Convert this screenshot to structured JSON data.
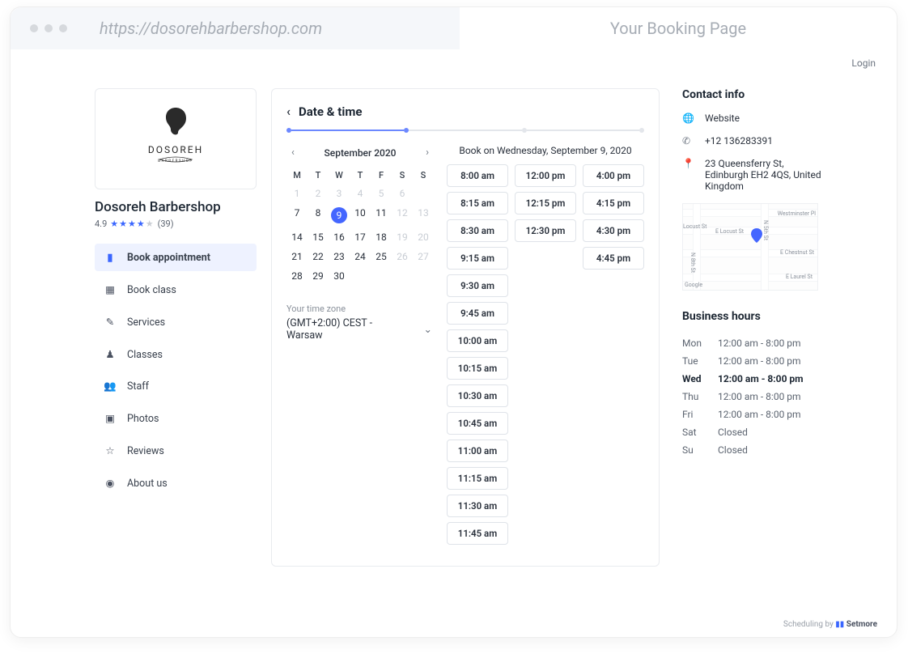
{
  "browser": {
    "url": "https://dosorehbarbershop.com",
    "tab_title": "Your Booking Page",
    "login": "Login"
  },
  "business": {
    "brand_top": "DOSOREH",
    "brand_sub": "BARBERSHOP",
    "name": "Dosoreh Barbershop",
    "rating": "4.9",
    "reviews_count": "(39)"
  },
  "nav": [
    {
      "icon": "briefcase",
      "label": "Book appointment",
      "active": true
    },
    {
      "icon": "calendar",
      "label": "Book class"
    },
    {
      "icon": "pencil",
      "label": "Services"
    },
    {
      "icon": "pawn",
      "label": "Classes"
    },
    {
      "icon": "users",
      "label": "Staff"
    },
    {
      "icon": "image",
      "label": "Photos"
    },
    {
      "icon": "star",
      "label": "Reviews"
    },
    {
      "icon": "pin",
      "label": "About us"
    }
  ],
  "main": {
    "title": "Date & time",
    "calendar": {
      "month_label": "September 2020",
      "dow": [
        "M",
        "T",
        "W",
        "T",
        "F",
        "S",
        "S"
      ],
      "weeks": [
        [
          {
            "n": "1",
            "dim": true
          },
          {
            "n": "2",
            "dim": true
          },
          {
            "n": "3",
            "dim": true
          },
          {
            "n": "4",
            "dim": true
          },
          {
            "n": "5",
            "dim": true
          },
          {
            "n": "6",
            "dim": true
          },
          {
            "n": "",
            "dim": true
          }
        ],
        [
          {
            "n": "7"
          },
          {
            "n": "8"
          },
          {
            "n": "9",
            "sel": true
          },
          {
            "n": "10"
          },
          {
            "n": "11"
          },
          {
            "n": "12",
            "dim": true
          },
          {
            "n": "13",
            "dim": true
          }
        ],
        [
          {
            "n": "14"
          },
          {
            "n": "15"
          },
          {
            "n": "16"
          },
          {
            "n": "17"
          },
          {
            "n": "18"
          },
          {
            "n": "19",
            "dim": true
          },
          {
            "n": "20",
            "dim": true
          }
        ],
        [
          {
            "n": "21"
          },
          {
            "n": "22"
          },
          {
            "n": "23"
          },
          {
            "n": "24"
          },
          {
            "n": "25"
          },
          {
            "n": "26",
            "dim": true
          },
          {
            "n": "27",
            "dim": true
          }
        ],
        [
          {
            "n": "28"
          },
          {
            "n": "29"
          },
          {
            "n": "30"
          },
          {
            "n": "",
            "dim": true
          },
          {
            "n": "",
            "dim": true
          },
          {
            "n": "",
            "dim": true
          },
          {
            "n": "",
            "dim": true
          }
        ]
      ],
      "tz_label": "Your time zone",
      "tz_value": "(GMT+2:00) CEST - Warsaw"
    },
    "slots_title": "Book on Wednesday, September 9, 2020",
    "slot_columns": [
      [
        "8:00 am",
        "8:15 am",
        "8:30 am",
        "9:15 am",
        "9:30 am",
        "9:45 am",
        "10:00 am",
        "10:15 am",
        "10:30 am",
        "10:45 am",
        "11:00 am",
        "11:15 am",
        "11:30 am",
        "11:45 am"
      ],
      [
        "12:00 pm",
        "12:15 pm",
        "12:30 pm"
      ],
      [
        "4:00 pm",
        "4:15 pm",
        "4:30 pm",
        "4:45 pm"
      ]
    ]
  },
  "contact": {
    "title": "Contact info",
    "website": "Website",
    "phone": "+12 136283391",
    "address": "23 Queensferry St, Edinburgh EH2 4QS, United Kingdom",
    "map_labels": {
      "west_pl": "Westminster Pl",
      "locust": "Locust St",
      "e_locust": "E Locust St",
      "n5th": "N 5th St",
      "echest": "E Chestnut St",
      "n8th": "N 8th St",
      "elaurel": "E Laurel St",
      "google": "Google"
    }
  },
  "hours": {
    "title": "Business hours",
    "rows": [
      {
        "d": "Mon",
        "h": "12:00 am - 8:00 pm"
      },
      {
        "d": "Tue",
        "h": "12:00 am - 8:00 pm"
      },
      {
        "d": "Wed",
        "h": "12:00 am - 8:00 pm",
        "bold": true
      },
      {
        "d": "Thu",
        "h": "12:00 am - 8:00 pm"
      },
      {
        "d": "Fri",
        "h": "12:00 am - 8:00 pm"
      },
      {
        "d": "Sat",
        "h": "Closed"
      },
      {
        "d": "Su",
        "h": "Closed"
      }
    ]
  },
  "footer": {
    "pre": "Scheduling by ",
    "brand": "Setmore"
  }
}
